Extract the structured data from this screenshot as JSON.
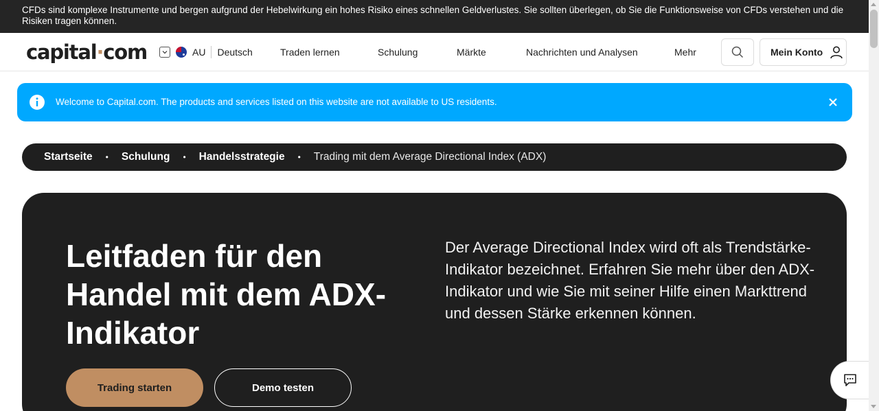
{
  "risk_warning": "CFDs sind komplexe Instrumente und bergen aufgrund der Hebelwirkung ein hohes Risiko eines schnellen Geldverlustes. Sie sollten überlegen, ob Sie die Funktionsweise von CFDs verstehen und die Risiken tragen können.",
  "header": {
    "logo": {
      "part1": "capital",
      "dot": "·",
      "part2": "com"
    },
    "country_code": "AU",
    "language": "Deutsch",
    "nav": [
      "Traden lernen",
      "Schulung",
      "Märkte",
      "Nachrichten und Analysen",
      "Mehr"
    ],
    "account_label": "Mein Konto"
  },
  "banner": {
    "text": "Welcome to Capital.com. The products and services listed on this website are not available to US residents."
  },
  "breadcrumb": {
    "items": [
      "Startseite",
      "Schulung",
      "Handelsstrategie"
    ],
    "current": "Trading mit dem Average Directional Index (ADX)",
    "separator": "•"
  },
  "hero": {
    "title": "Leitfaden für den Handel mit dem ADX-Indikator",
    "description": "Der Average Directional Index wird oft als Trendstärke-Indikator bezeichnet. Erfahren Sie mehr über den ADX-Indikator und wie Sie mit seiner Hilfe einen Markttrend und dessen Stärke erkennen können.",
    "primary_button": "Trading starten",
    "secondary_button": "Demo testen"
  },
  "colors": {
    "accent": "#c08e62",
    "banner_blue": "#00a8ff",
    "dark": "#1f1f1f"
  },
  "icons": [
    "chevron-down-icon",
    "flag-au-icon",
    "search-icon",
    "user-icon",
    "info-icon",
    "close-icon",
    "chat-icon"
  ]
}
